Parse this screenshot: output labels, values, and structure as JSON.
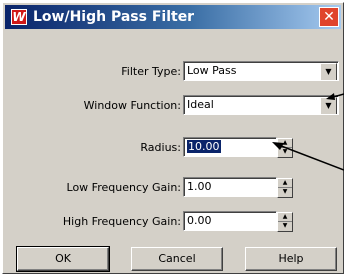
{
  "window": {
    "title": "Low/High Pass Filter",
    "close_glyph": "✕"
  },
  "form": {
    "filter_type": {
      "label": "Filter Type:",
      "value": "Low Pass"
    },
    "window_function": {
      "label": "Window Function:",
      "value": "Ideal"
    },
    "radius": {
      "label": "Radius:",
      "value": "10.00"
    },
    "low_gain": {
      "label": "Low Frequency Gain:",
      "value": "1.00"
    },
    "high_gain": {
      "label": "High Frequency Gain:",
      "value": "0.00"
    }
  },
  "buttons": {
    "ok": "OK",
    "cancel": "Cancel",
    "help": "Help"
  },
  "colors": {
    "titlebar": "#0a246a",
    "dialog_face": "#d4d0c8",
    "selection": "#0a246a"
  }
}
